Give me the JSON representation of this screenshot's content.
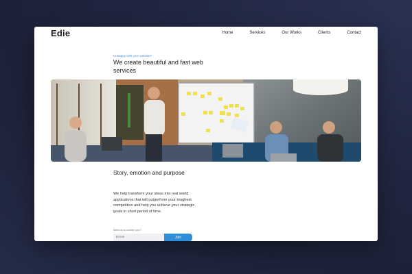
{
  "site": {
    "logo": "Edie",
    "nav": [
      "Home",
      "Services",
      "Our Works",
      "Clients",
      "Contact"
    ]
  },
  "hero": {
    "eyebrow": "Unhappy with your website?",
    "headline": "We create beautiful and fast web services",
    "image_alt": "Team meeting around a whiteboard with sticky notes"
  },
  "about": {
    "title": "Story, emotion and purpose",
    "body": "We help transform your ideas into real world applications that will outperform your toughest competition and help you achieve your strategic goals in short period of time."
  },
  "signup": {
    "label": "Want us to contact you?",
    "email_placeholder": "Email",
    "button_label": "Join"
  },
  "colors": {
    "accent": "#2f8fd8",
    "background": "#1f2540"
  }
}
